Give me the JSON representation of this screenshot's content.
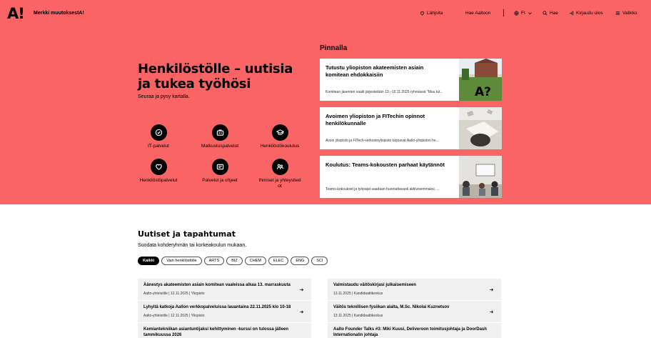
{
  "header": {
    "logo": "A!",
    "brand_link": "Merkki muutoksestA!",
    "nav": {
      "shortcuts": "Lähjsita",
      "search_aalto": "Hae Aaltoon",
      "language": "FI",
      "search": "Hae",
      "logout": "Kirjaudu ulos",
      "menu": "Valikko"
    }
  },
  "hero": {
    "title": "Henkilöstölle – uutisia ja tukea työhösi",
    "subtitle": "Seuraa ja pysy kartalla.",
    "services": [
      {
        "label": "IT-palvelut",
        "icon": "check-circle-icon"
      },
      {
        "label": "Matkustuspalvelut",
        "icon": "briefcase-icon"
      },
      {
        "label": "Henkilöstökoulutus",
        "icon": "graduation-cap-icon"
      },
      {
        "label": "Henkilöstöpalvelut",
        "icon": "heart-icon"
      },
      {
        "label": "Palvelut ja ohjeet",
        "icon": "document-icon"
      },
      {
        "label": "Ihmiset ja yhteystiedot",
        "icon": "people-icon"
      }
    ]
  },
  "pinnalla": {
    "title": "Pinnalla",
    "cards": [
      {
        "title": "Tutustu yliopiston akateemisten asiain komitean ehdokkaisiin",
        "desc": "Komitean jäsenten vaalit järjestetään 13.–19.11.2025 ryhmässä \"Muu tut..."
      },
      {
        "title": "Avoimen yliopiston ja FITechin opinnot henkilökunnalle",
        "desc": "Avoin yliopisto ja FITech-verkostoyliopisto tarjoavat Aalto-yliopiston he..."
      },
      {
        "title": "Koulutus: Teams-kokousten parhaat käytännöt",
        "desc": "Teams-kokoukset ja työpajat saadaan huomattavasti aktiivisemmaksi, ..."
      }
    ]
  },
  "news": {
    "title": "Uutiset ja tapahtumat",
    "subtitle": "Suodata kohderyhmän tai korkeakoulun mukaan.",
    "filters": [
      "Kaikki",
      "Vain henkilöstölle",
      "ARTS",
      "BIZ",
      "CHEM",
      "ELEC",
      "ENG",
      "SCI"
    ],
    "left": [
      {
        "title": "Äänestys akateemisten asiain komitean vaaleissa alkaa 13. marraskuuta",
        "meta": "Aalto-yhteisölle | 12.11.2025 | Yliopisto"
      },
      {
        "title": "Lyhyitä katkoja Aallon verkkopalveluissa lauantaina 22.11.2025 klo 10-18",
        "meta": "Aalto-yhteisölle | 12.11.2025 | Yliopisto"
      },
      {
        "title": "Kemiantekniikan asiantuntijaksi kehittyminen -kurssi on tulossa jälleen tammikuussa 2026",
        "meta": ""
      }
    ],
    "right": [
      {
        "title": "Valmistaudu väitöskirjasi julkaisemiseen",
        "meta": "13.11.2025 | Kandidaattikeskus"
      },
      {
        "title": "Väitös teknillisen fysiikan alalta, M.Sc. Nikolai Kuznetsov",
        "meta": "13.11.2025 | Kandidaattikeskus"
      },
      {
        "title": "Aalto Founder Talks #3: Miki Kuusi, Deliveroon toimitusjohtaja ja DoorDash Internationalin johtaja",
        "meta": ""
      }
    ]
  }
}
